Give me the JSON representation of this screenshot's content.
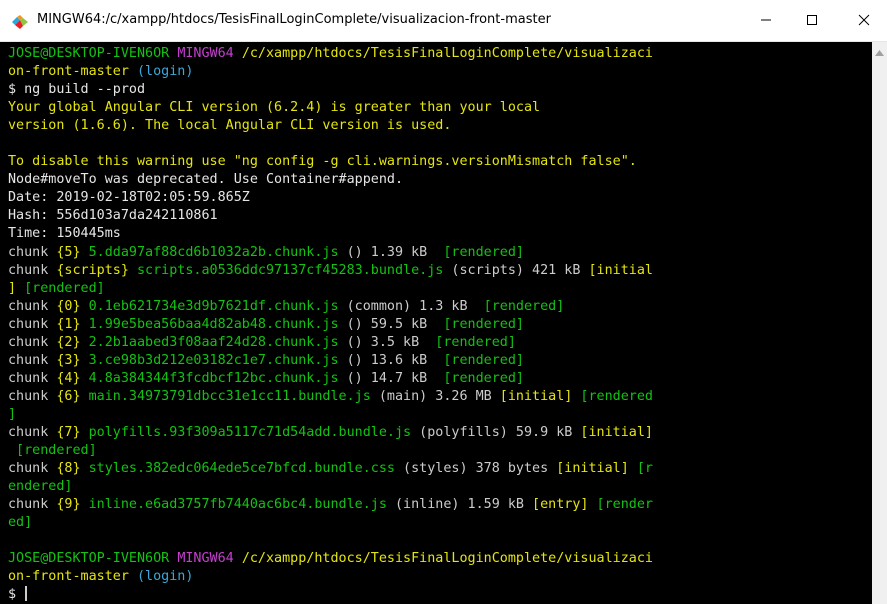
{
  "window": {
    "title": "MINGW64:/c/xampp/htdocs/TesisFinalLoginComplete/visualizacion-front-master",
    "icon": "mingw-app-icon"
  },
  "controls": {
    "minimize": "minimize-icon",
    "maximize": "maximize-icon",
    "close": "close-icon"
  },
  "prompt": {
    "user": "JOSE@DESKTOP-IVEN6OR",
    "env": "MINGW64",
    "path_line1": "/c/xampp/htdocs/TesisFinalLoginComplete/visualizaci",
    "path_line2": "on-front-master",
    "branch": "(login)",
    "symbol": "$"
  },
  "command": "ng build --prod",
  "warning": {
    "line1": "Your global Angular CLI version (6.2.4) is greater than your local",
    "line2": "version (1.6.6). The local Angular CLI version is used.",
    "line3": "To disable this warning use \"ng config -g cli.warnings.versionMismatch false\"."
  },
  "deprecation": "Node#moveTo was deprecated. Use Container#append.",
  "build_info": {
    "date": "Date: 2019-02-18T02:05:59.865Z",
    "hash": "Hash: 556d103a7da242110861",
    "time": "Time: 150445ms"
  },
  "chunks": {
    "c5_a": "chunk ",
    "c5_b": "{5}",
    "c5_c": " 5.dda97af88cd6b1032a2b.chunk.js",
    "c5_d": " () 1.39 kB  ",
    "c5_e": "[rendered]",
    "cs_a": "chunk ",
    "cs_b": "{scripts}",
    "cs_c": " scripts.a0536ddc97137cf45283.bundle.js",
    "cs_d": " (scripts) 421 kB ",
    "cs_e": "[initial",
    "cs2_a": "]",
    "cs2_b": " [rendered]",
    "c0_a": "chunk ",
    "c0_b": "{0}",
    "c0_c": " 0.1eb621734e3d9b7621df.chunk.js",
    "c0_d": " (common) 1.3 kB  ",
    "c0_e": "[rendered]",
    "c1_a": "chunk ",
    "c1_b": "{1}",
    "c1_c": " 1.99e5bea56baa4d82ab48.chunk.js",
    "c1_d": " () 59.5 kB  ",
    "c1_e": "[rendered]",
    "c2_a": "chunk ",
    "c2_b": "{2}",
    "c2_c": " 2.2b1aabed3f08aaf24d28.chunk.js",
    "c2_d": " () 3.5 kB  ",
    "c2_e": "[rendered]",
    "c3_a": "chunk ",
    "c3_b": "{3}",
    "c3_c": " 3.ce98b3d212e03182c1e7.chunk.js",
    "c3_d": " () 13.6 kB  ",
    "c3_e": "[rendered]",
    "c4_a": "chunk ",
    "c4_b": "{4}",
    "c4_c": " 4.8a384344f3fcdbcf12bc.chunk.js",
    "c4_d": " () 14.7 kB  ",
    "c4_e": "[rendered]",
    "c6_a": "chunk ",
    "c6_b": "{6}",
    "c6_c": " main.34973791dbcc31e1cc11.bundle.js",
    "c6_d": " (main) 3.26 MB ",
    "c6_e": "[initial]",
    "c6_f": " [rendered",
    "c6_2": "]",
    "c7_a": "chunk ",
    "c7_b": "{7}",
    "c7_c": " polyfills.93f309a5117c71d54add.bundle.js",
    "c7_d": " (polyfills) 59.9 kB ",
    "c7_e": "[initial]",
    "c7_2": " [rendered]",
    "c8_a": "chunk ",
    "c8_b": "{8}",
    "c8_c": " styles.382edc064ede5ce7bfcd.bundle.css",
    "c8_d": " (styles) 378 bytes ",
    "c8_e": "[initial]",
    "c8_f": " [r",
    "c8_2": "endered]",
    "c9_a": "chunk ",
    "c9_b": "{9}",
    "c9_c": " inline.e6ad3757fb7440ac6bc4.bundle.js",
    "c9_d": " (inline) 1.59 kB ",
    "c9_e": "[entry]",
    "c9_f": " [render",
    "c9_2": "ed]"
  },
  "colors": {
    "green": "#13c213",
    "magenta": "#c63fd0",
    "yellow": "#e5e510",
    "cyan": "#3aa8d8",
    "text": "#cccccc",
    "background": "#000000"
  }
}
